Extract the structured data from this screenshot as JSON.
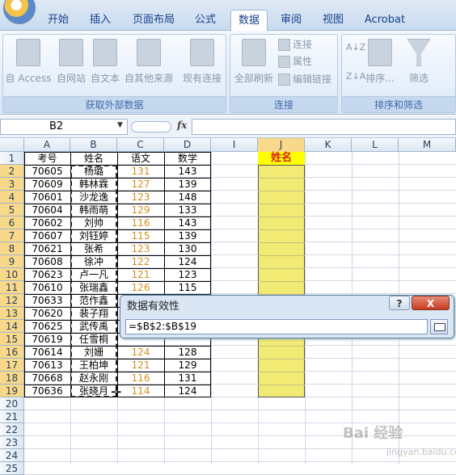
{
  "tabs": [
    {
      "label": "开始",
      "active": false
    },
    {
      "label": "插入",
      "active": false
    },
    {
      "label": "页面布局",
      "active": false
    },
    {
      "label": "公式",
      "active": false
    },
    {
      "label": "数据",
      "active": true
    },
    {
      "label": "审阅",
      "active": false
    },
    {
      "label": "视图",
      "active": false
    },
    {
      "label": "Acrobat",
      "active": false
    }
  ],
  "ribbon": {
    "external": {
      "label": "获取外部数据",
      "buttons": [
        "自 Access",
        "自网站",
        "自文本",
        "自其他来源",
        "现有连接"
      ]
    },
    "connections": {
      "label": "连接",
      "refresh_all": "全部刷新",
      "items": [
        "连接",
        "属性",
        "编辑链接"
      ]
    },
    "sort": {
      "label": "排序和筛选",
      "sort": "排序...",
      "filter": "筛选"
    }
  },
  "formula_bar": {
    "name_box": "B2",
    "fx": "fx",
    "value": ""
  },
  "sheet": {
    "columns": [
      "A",
      "B",
      "C",
      "D",
      "I",
      "J",
      "K",
      "L",
      "M"
    ],
    "selected_column": "J",
    "rows": [
      "1",
      "2",
      "3",
      "4",
      "5",
      "6",
      "7",
      "8",
      "9",
      "10",
      "11",
      "12",
      "13",
      "14",
      "15",
      "16",
      "17",
      "18",
      "19",
      "20",
      "21",
      "22",
      "23",
      "24",
      "25"
    ],
    "headers": [
      "考号",
      "姓名",
      "语文",
      "数学"
    ],
    "j_header": "姓名",
    "data": [
      [
        "70605",
        "杨璐",
        "131",
        "143"
      ],
      [
        "70609",
        "韩林霖",
        "127",
        "139"
      ],
      [
        "70601",
        "沙龙逸",
        "123",
        "148"
      ],
      [
        "70604",
        "韩雨萌",
        "129",
        "133"
      ],
      [
        "70602",
        "刘帅",
        "116",
        "143"
      ],
      [
        "70607",
        "刘钰婷",
        "115",
        "139"
      ],
      [
        "70621",
        "张希",
        "123",
        "130"
      ],
      [
        "70608",
        "徐冲",
        "122",
        "124"
      ],
      [
        "70623",
        "卢一凡",
        "121",
        "123"
      ],
      [
        "70610",
        "张瑞鑫",
        "126",
        "115"
      ],
      [
        "70633",
        "范作鑫",
        "",
        ""
      ],
      [
        "70620",
        "裴子翔",
        "",
        ""
      ],
      [
        "70625",
        "武传禹",
        "",
        ""
      ],
      [
        "70619",
        "任雪桐",
        "",
        ""
      ],
      [
        "70614",
        "刘姗",
        "124",
        "128"
      ],
      [
        "70613",
        "王柏坤",
        "121",
        "129"
      ],
      [
        "70668",
        "赵永刚",
        "116",
        "131"
      ],
      [
        "70636",
        "张晓月",
        "114",
        "124"
      ]
    ]
  },
  "dialog": {
    "title": "数据有效性",
    "help": "?",
    "close": "X",
    "formula": "=$B$2:$B$19"
  },
  "watermark": {
    "text": "Bai 经验",
    "url": "jingyan.baidu.com"
  }
}
